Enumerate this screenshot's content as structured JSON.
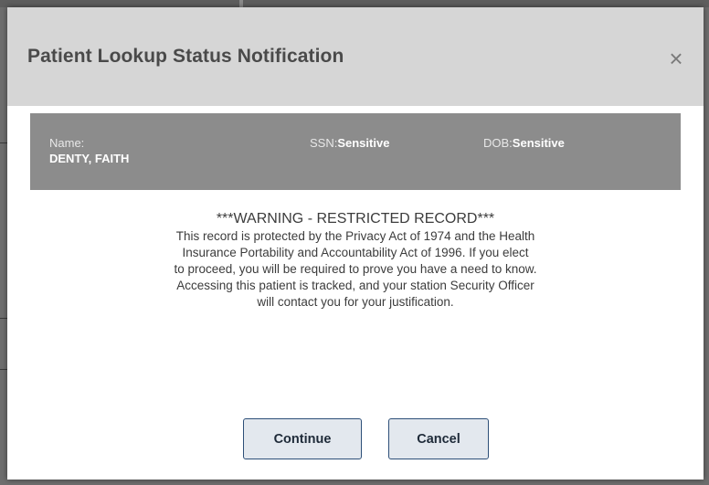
{
  "dialog": {
    "title": "Patient Lookup Status Notification",
    "close_symbol": "×"
  },
  "patient": {
    "name_label": "Name:",
    "name_value": "DENTY, FAITH",
    "ssn_label": "SSN:",
    "ssn_value": "Sensitive",
    "dob_label": "DOB:",
    "dob_value": "Sensitive"
  },
  "message": {
    "warning_heading": "***WARNING - RESTRICTED RECORD***",
    "lines": [
      "This record is protected by the Privacy Act of 1974 and the Health",
      "Insurance Portability and Accountability Act of 1996. If you elect",
      "to proceed, you will be required to prove you have a need to know.",
      "Accessing this patient is tracked, and your station Security Officer",
      "will contact you for your justification."
    ]
  },
  "buttons": {
    "continue_label": "Continue",
    "cancel_label": "Cancel"
  },
  "colors": {
    "header_bg": "#d6d6d6",
    "info_bar_bg": "#8c8c8c",
    "button_border": "#2d4f78",
    "button_bg": "#e3e8ee"
  },
  "icons": {
    "close": "close-icon"
  }
}
